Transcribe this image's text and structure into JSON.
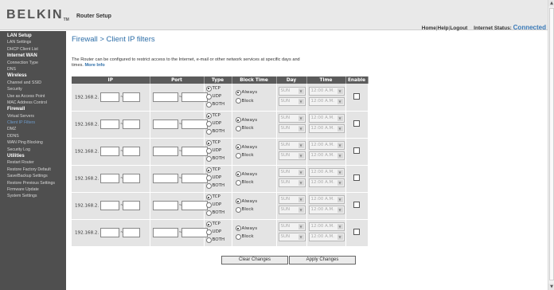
{
  "header": {
    "logo": "BELKIN",
    "logo_tm": "TM",
    "title": "Router Setup",
    "links": [
      "Home",
      "Help",
      "Logout"
    ],
    "status_label": "Internet Status:",
    "status_value": "Connected"
  },
  "sidebar": {
    "items": [
      {
        "label": "LAN Setup",
        "section": true
      },
      {
        "label": "LAN Settings"
      },
      {
        "label": "DHCP Client List"
      },
      {
        "label": "Internet WAN",
        "section": true
      },
      {
        "label": "Connection Type"
      },
      {
        "label": "DNS"
      },
      {
        "label": "Wireless",
        "section": true
      },
      {
        "label": "Channel and SSID"
      },
      {
        "label": "Security"
      },
      {
        "label": "Use as Access Point"
      },
      {
        "label": "MAC Address Control"
      },
      {
        "label": "Firewall",
        "section": true
      },
      {
        "label": "Virtual Servers"
      },
      {
        "label": "Client IP Filters",
        "active": true
      },
      {
        "label": "DMZ"
      },
      {
        "label": "DDNS"
      },
      {
        "label": "WAN Ping Blocking"
      },
      {
        "label": "Security Log"
      },
      {
        "label": "Utilities",
        "section": true
      },
      {
        "label": "Restart Router"
      },
      {
        "label": "Restore Factory Default"
      },
      {
        "label": "Save/Backup Settings"
      },
      {
        "label": "Restore Previous Settings"
      },
      {
        "label": "Firmware Update"
      },
      {
        "label": "System Settings"
      }
    ]
  },
  "main": {
    "title": "Firewall > Client IP filters",
    "intro": "The Router can be configured to restrict access to the Internet, e-mail or other network services at specific days and times.",
    "more_info": "More Info",
    "columns": [
      "IP",
      "Port",
      "Type",
      "Block Time",
      "Day",
      "Time",
      "Enable"
    ],
    "ip_prefix": "192.168.2.",
    "dash": "~",
    "type_options": [
      "TCP",
      "UDP",
      "BOTH"
    ],
    "block_options": [
      "Always",
      "Block"
    ],
    "day_value": "SUN",
    "time_value": "12:00 A.M.",
    "rows": [
      {
        "type": "TCP",
        "block": "Always",
        "enabled": false
      },
      {
        "type": "TCP",
        "block": "Always",
        "enabled": false
      },
      {
        "type": "TCP",
        "block": "Always",
        "enabled": false
      },
      {
        "type": "TCP",
        "block": "Always",
        "enabled": false
      },
      {
        "type": "TCP",
        "block": "Always",
        "enabled": false
      },
      {
        "type": "TCP",
        "block": "Always",
        "enabled": false
      }
    ],
    "buttons": {
      "clear": "Clear Changes",
      "apply": "Apply Changes"
    }
  }
}
